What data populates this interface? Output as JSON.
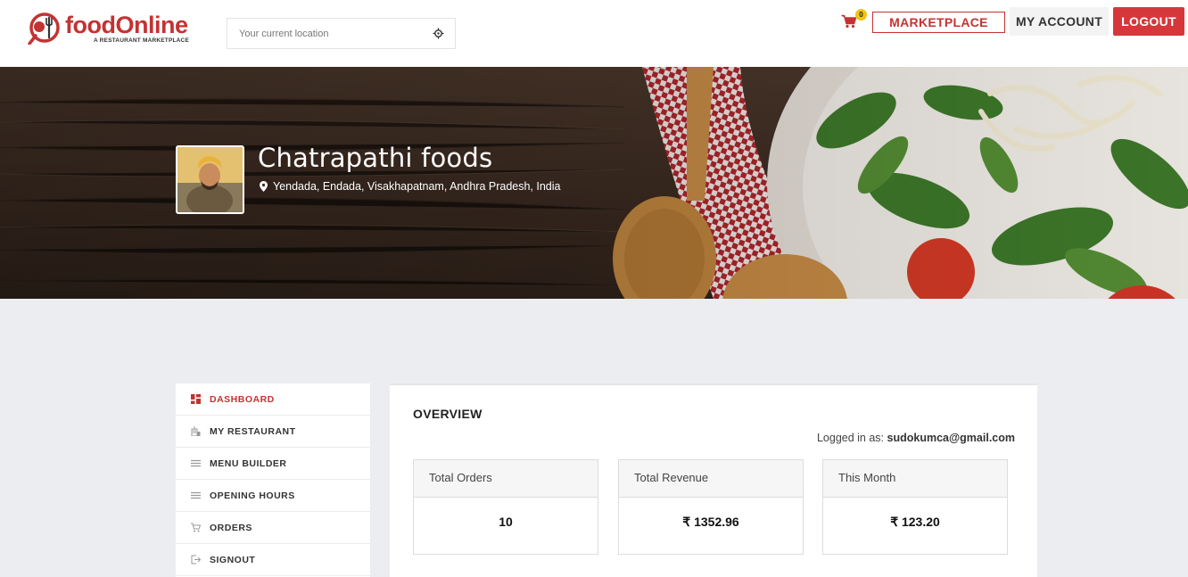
{
  "brand": {
    "name": "foodOnline",
    "tagline": "A RESTAURANT MARKETPLACE",
    "color": "#c33332"
  },
  "header": {
    "location_placeholder": "Your current location",
    "cart_count": "0",
    "marketplace_label": "MARKETPLACE",
    "account_label": "MY ACCOUNT",
    "logout_label": "LOGOUT"
  },
  "banner": {
    "restaurant_name": "Chatrapathi foods",
    "address": "Yendada, Endada, Visakhapatnam, Andhra Pradesh, India"
  },
  "sidebar": {
    "items": [
      {
        "label": "DASHBOARD",
        "icon": "dashboard-icon",
        "active": true
      },
      {
        "label": "MY RESTAURANT",
        "icon": "restaurant-icon",
        "active": false
      },
      {
        "label": "MENU BUILDER",
        "icon": "menu-lines-icon",
        "active": false
      },
      {
        "label": "OPENING HOURS",
        "icon": "menu-lines-icon",
        "active": false
      },
      {
        "label": "ORDERS",
        "icon": "cart-icon",
        "active": false
      },
      {
        "label": "SIGNOUT",
        "icon": "signout-icon",
        "active": false
      }
    ]
  },
  "overview": {
    "title": "OVERVIEW",
    "logged_in_prefix": "Logged in as:",
    "logged_in_email": "sudokumca@gmail.com",
    "stats": [
      {
        "label": "Total Orders",
        "value": "10"
      },
      {
        "label": "Total Revenue",
        "value": "₹ 1352.96"
      },
      {
        "label": "This Month",
        "value": "₹ 123.20"
      }
    ]
  },
  "colors": {
    "accent": "#c33332",
    "logout_bg": "#d6373b",
    "badge": "#f1c40f",
    "page_bg": "#ecedf1"
  }
}
